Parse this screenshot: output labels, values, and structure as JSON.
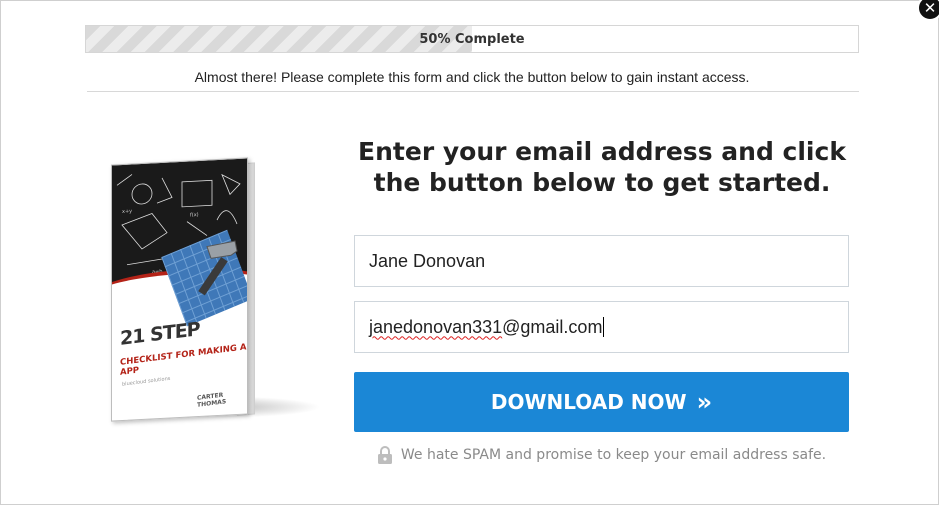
{
  "progress": {
    "label": "50% Complete",
    "percent": 50
  },
  "subtitle": "Almost there! Please complete this form and click the button below to gain instant access.",
  "book": {
    "title": "21 STEP",
    "subtitle": "CHECKLIST FOR MAKING AN APP",
    "author": "CARTER THOMAS",
    "brand": "bluecloud solutions"
  },
  "heading": {
    "line1": "Enter your email address and click",
    "line2": "the button below to get started."
  },
  "form": {
    "name_value": "Jane Donovan",
    "email_local": "janedonovan331",
    "email_domain": "@gmail.com"
  },
  "cta": {
    "label": "DOWNLOAD NOW",
    "arrows": "»"
  },
  "privacy_text": "We hate SPAM and promise to keep your email address safe.",
  "close_symbol": "✕",
  "colors": {
    "button": "#1b87d6",
    "accent_red": "#b42318"
  },
  "icons": [
    "close-icon",
    "lock-icon",
    "double-chevron-right-icon"
  ]
}
